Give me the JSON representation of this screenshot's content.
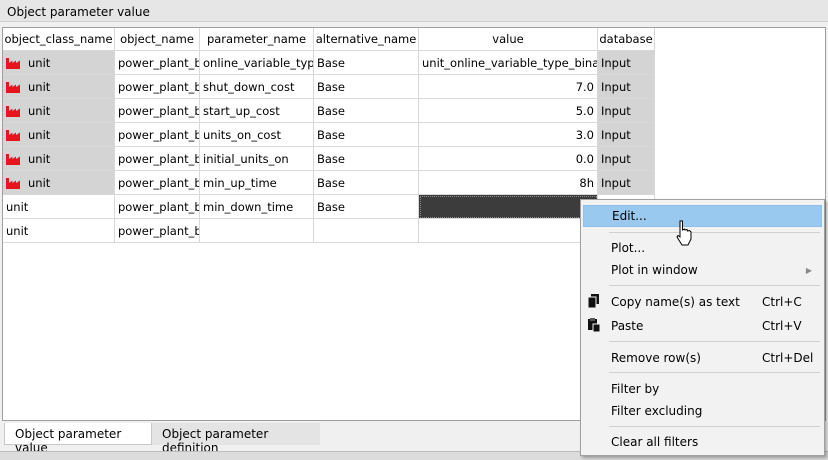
{
  "window": {
    "title": "Object parameter value"
  },
  "table": {
    "columns": [
      "object_class_name",
      "object_name",
      "parameter_name",
      "alternative_name",
      "value",
      "database"
    ],
    "rows": [
      {
        "class": "unit",
        "object": "power_plant_b",
        "parameter": "online_variable_type",
        "alternative": "Base",
        "value": "unit_online_variable_type_binary",
        "database": "Input"
      },
      {
        "class": "unit",
        "object": "power_plant_b",
        "parameter": "shut_down_cost",
        "alternative": "Base",
        "value": "7.0",
        "database": "Input"
      },
      {
        "class": "unit",
        "object": "power_plant_b",
        "parameter": "start_up_cost",
        "alternative": "Base",
        "value": "5.0",
        "database": "Input"
      },
      {
        "class": "unit",
        "object": "power_plant_b",
        "parameter": "units_on_cost",
        "alternative": "Base",
        "value": "3.0",
        "database": "Input"
      },
      {
        "class": "unit",
        "object": "power_plant_b",
        "parameter": "initial_units_on",
        "alternative": "Base",
        "value": "0.0",
        "database": "Input"
      },
      {
        "class": "unit",
        "object": "power_plant_b",
        "parameter": "min_up_time",
        "alternative": "Base",
        "value": "8h",
        "database": "Input"
      },
      {
        "class": "unit",
        "object": "power_plant_b",
        "parameter": "min_down_time",
        "alternative": "Base",
        "value": "",
        "database": ""
      },
      {
        "class": "unit",
        "object": "power_plant_b",
        "parameter": "",
        "alternative": "",
        "value": "",
        "database": ""
      }
    ]
  },
  "tabs": [
    "Object parameter value",
    "Object parameter definition"
  ],
  "context_menu": {
    "items": [
      {
        "label": "Edit...",
        "shortcut": ""
      },
      {
        "label": "Plot...",
        "shortcut": ""
      },
      {
        "label": "Plot in window",
        "shortcut": ""
      },
      {
        "label": "Copy name(s) as text",
        "shortcut": "Ctrl+C"
      },
      {
        "label": "Paste",
        "shortcut": "Ctrl+V"
      },
      {
        "label": "Remove row(s)",
        "shortcut": "Ctrl+Del"
      },
      {
        "label": "Filter by",
        "shortcut": ""
      },
      {
        "label": "Filter excluding",
        "shortcut": ""
      },
      {
        "label": "Clear all filters",
        "shortcut": ""
      }
    ]
  },
  "colors": {
    "factory_icon": "#e8141e",
    "highlight": "#99c9ef",
    "selected_cell": "#3c3c3c"
  },
  "icons": {
    "row_icon": "factory-icon",
    "submenu": "chevron-right-icon",
    "copy": "copy-icon",
    "paste": "paste-icon"
  }
}
